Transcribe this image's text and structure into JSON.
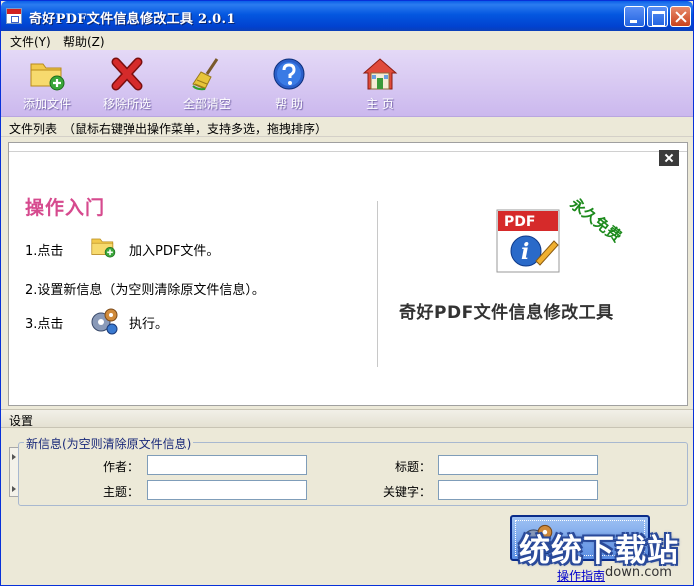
{
  "window": {
    "title": "奇好PDF文件信息修改工具 2.0.1"
  },
  "menu": {
    "file": "文件(Y)",
    "help": "帮助(Z)"
  },
  "toolbar": {
    "add": "添加文件",
    "remove": "移除所选",
    "clear": "全部清空",
    "help": "帮 助",
    "home": "主 页"
  },
  "file_list": {
    "label": "文件列表　（鼠标右键弹出操作菜单，支持多选，拖拽排序）"
  },
  "guide": {
    "title": "操作入门",
    "step1_prefix": "1.点击",
    "step1_suffix": "加入PDF文件。",
    "step2": "2.设置新信息（为空则清除原文件信息）。",
    "step3_prefix": "3.点击",
    "step3_suffix": "执行。",
    "free_badge": "永久免费",
    "pdf_logo_text": "PDF",
    "product_name": "奇好PDF文件信息修改工具"
  },
  "settings": {
    "bar_label": "设置",
    "group_legend": "新信息(为空则清除原文件信息)",
    "author_label": "作者：",
    "subject_label": "主题：",
    "title_label": "标题：",
    "keywords_label": "关键字：",
    "author_value": "",
    "subject_value": "",
    "title_value": "",
    "keywords_value": ""
  },
  "footer": {
    "guide_link": "操作指南",
    "watermark": "统统下载站",
    "watermark_url": "down.com"
  },
  "colors": {
    "titlebar": "#0457e0",
    "toolbar": "#d8c9f2",
    "guide_title": "#d64a8e",
    "free_badge": "#1c8a1c"
  }
}
